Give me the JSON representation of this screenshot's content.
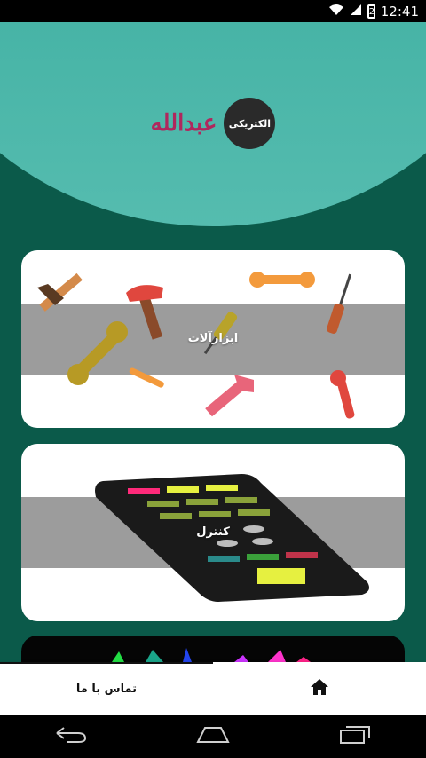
{
  "status_bar": {
    "time": "12:41",
    "battery_level": "2",
    "icons": [
      "wifi-icon",
      "signal-icon",
      "battery-icon"
    ]
  },
  "header": {
    "logo_badge_text": "الکتریکی",
    "title": "عبدالله",
    "colors": {
      "title": "#b0275d",
      "wave_top": "#2da596",
      "wave_bottom": "#55bcaf",
      "background": "#0b5a4a"
    }
  },
  "cards": [
    {
      "label": "ابزارآلات",
      "icon": "tools-collage"
    },
    {
      "label": "کنترل",
      "icon": "remote-control-illustration"
    },
    {
      "label": "",
      "icon": "colorful-illustration"
    }
  ],
  "bottom_nav": {
    "contact_label": "تماس با ما",
    "home_icon": "home-icon"
  },
  "system_nav": {
    "icons": [
      "back-icon",
      "home-outline-icon",
      "recents-icon"
    ]
  }
}
